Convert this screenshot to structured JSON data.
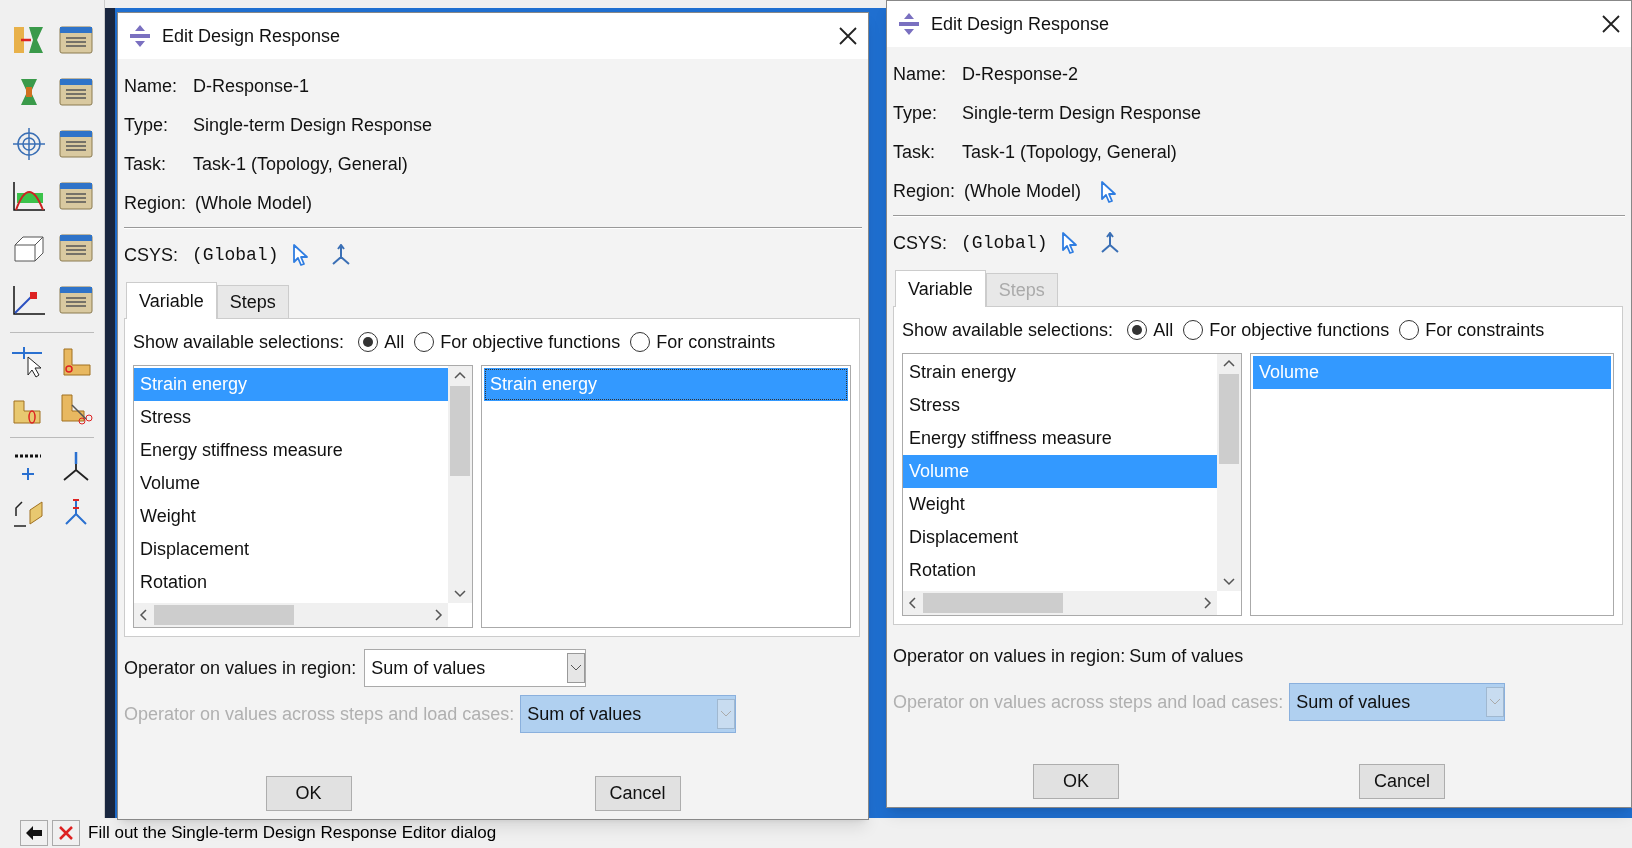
{
  "status_bar": {
    "prompt": "Fill out the Single-term Design Response Editor dialog"
  },
  "dialogs": [
    {
      "title": "Edit Design Response",
      "fields": [
        {
          "label": "Name:",
          "value": "D-Response-1"
        },
        {
          "label": "Type:",
          "value": "Single-term Design Response"
        },
        {
          "label": "Task:",
          "value": "Task-1 (Topology, General)"
        }
      ],
      "region": {
        "label": "Region:",
        "value": "(Whole Model)",
        "picker": false
      },
      "csys": {
        "label": "CSYS:",
        "value": "(Global)"
      },
      "tabs": [
        {
          "label": "Variable",
          "selected": true,
          "disabled": false
        },
        {
          "label": "Steps",
          "selected": false,
          "disabled": false
        }
      ],
      "selections": {
        "label": "Show available selections:",
        "options": [
          {
            "label": "All",
            "selected": true
          },
          {
            "label": "For objective functions",
            "selected": false
          },
          {
            "label": "For constraints",
            "selected": false
          }
        ]
      },
      "available": [
        {
          "label": "Strain energy",
          "selected": true
        },
        {
          "label": "Stress",
          "selected": false
        },
        {
          "label": "Energy stiffness measure",
          "selected": false
        },
        {
          "label": "Volume",
          "selected": false
        },
        {
          "label": "Weight",
          "selected": false
        },
        {
          "label": "Displacement",
          "selected": false
        },
        {
          "label": "Rotation",
          "selected": false
        }
      ],
      "chosen": [
        {
          "label": "Strain energy",
          "selected": true
        }
      ],
      "region_operator": {
        "kind": "dropdown",
        "label": "Operator on values in region:",
        "value": "Sum of values"
      },
      "steps_operator": {
        "label": "Operator on values across steps and load cases:",
        "value": "Sum of values",
        "disabled": true
      },
      "buttons": [
        "OK",
        "Cancel"
      ]
    },
    {
      "title": "Edit Design Response",
      "fields": [
        {
          "label": "Name:",
          "value": "D-Response-2"
        },
        {
          "label": "Type:",
          "value": "Single-term Design Response"
        },
        {
          "label": "Task:",
          "value": "Task-1 (Topology, General)"
        }
      ],
      "region": {
        "label": "Region:",
        "value": "(Whole Model)",
        "picker": true
      },
      "csys": {
        "label": "CSYS:",
        "value": "(Global)"
      },
      "tabs": [
        {
          "label": "Variable",
          "selected": true,
          "disabled": false
        },
        {
          "label": "Steps",
          "selected": false,
          "disabled": true
        }
      ],
      "selections": {
        "label": "Show available selections:",
        "options": [
          {
            "label": "All",
            "selected": true
          },
          {
            "label": "For objective functions",
            "selected": false
          },
          {
            "label": "For constraints",
            "selected": false
          }
        ]
      },
      "available": [
        {
          "label": "Strain energy",
          "selected": false
        },
        {
          "label": "Stress",
          "selected": false
        },
        {
          "label": "Energy stiffness measure",
          "selected": false
        },
        {
          "label": "Volume",
          "selected": true
        },
        {
          "label": "Weight",
          "selected": false
        },
        {
          "label": "Displacement",
          "selected": false
        },
        {
          "label": "Rotation",
          "selected": false
        }
      ],
      "chosen": [
        {
          "label": "Volume",
          "selected": true
        }
      ],
      "region_operator": {
        "kind": "text",
        "label": "Operator on values in region:",
        "value": "Sum of values"
      },
      "steps_operator": {
        "label": "Operator on values across steps and load cases:",
        "value": "Sum of values",
        "disabled": true
      },
      "buttons": [
        "OK",
        "Cancel"
      ]
    }
  ]
}
